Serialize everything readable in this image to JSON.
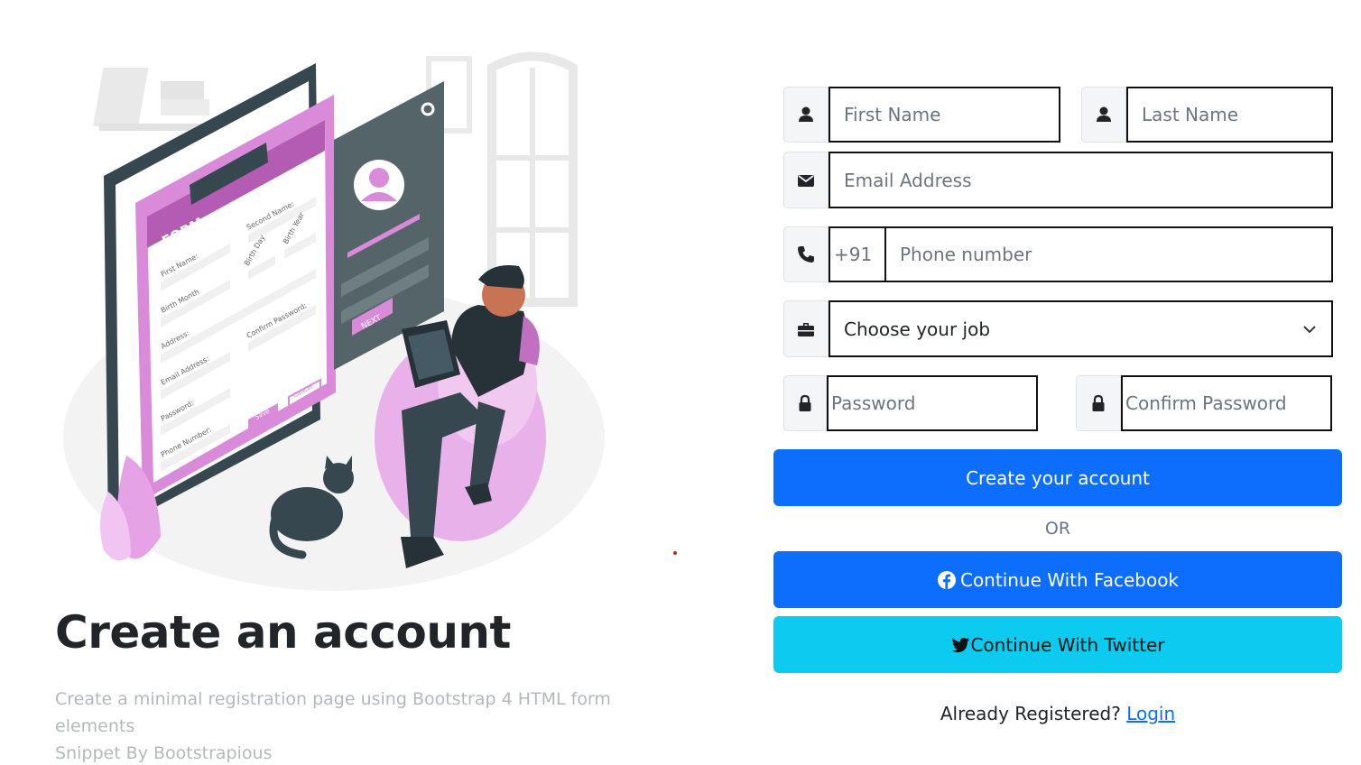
{
  "hero": {
    "title": "Create an account",
    "subtitle_line1": "Create a minimal registration page using Bootstrap 4 HTML form elements",
    "subtitle_line2": "Snippet By Bootstrapious",
    "illustration": {
      "form_title": "FORM",
      "labels": [
        "First Name:",
        "Second Name:",
        "Birth Month",
        "Birth Day",
        "Birth Year",
        "Address:",
        "Email Address:",
        "Confirm Password:",
        "Password:",
        "Phone Number:"
      ],
      "save_label": "Save",
      "cancel_label": "Cancel",
      "next_label": "NEXT"
    }
  },
  "form": {
    "first_name": {
      "placeholder": "First Name",
      "icon": "user-icon"
    },
    "last_name": {
      "placeholder": "Last Name",
      "icon": "user-icon"
    },
    "email": {
      "placeholder": "Email Address",
      "icon": "envelope-icon"
    },
    "phone": {
      "prefix": "+91",
      "placeholder": "Phone number",
      "icon": "phone-icon"
    },
    "job": {
      "selected": "Choose your job",
      "icon": "briefcase-icon"
    },
    "password": {
      "placeholder": "Password",
      "icon": "lock-icon"
    },
    "confirm_password": {
      "placeholder": "Confirm Password",
      "icon": "lock-icon"
    },
    "submit_label": "Create your account",
    "or_label": "OR",
    "facebook_label": "Continue With Facebook",
    "twitter_label": "Continue With Twitter",
    "already_text": "Already Registered?",
    "login_label": "Login"
  },
  "colors": {
    "primary": "#0d6efd",
    "twitter": "#0dcaf0",
    "illustration_pink": "#d98ad9",
    "illustration_dark": "#37474f"
  }
}
